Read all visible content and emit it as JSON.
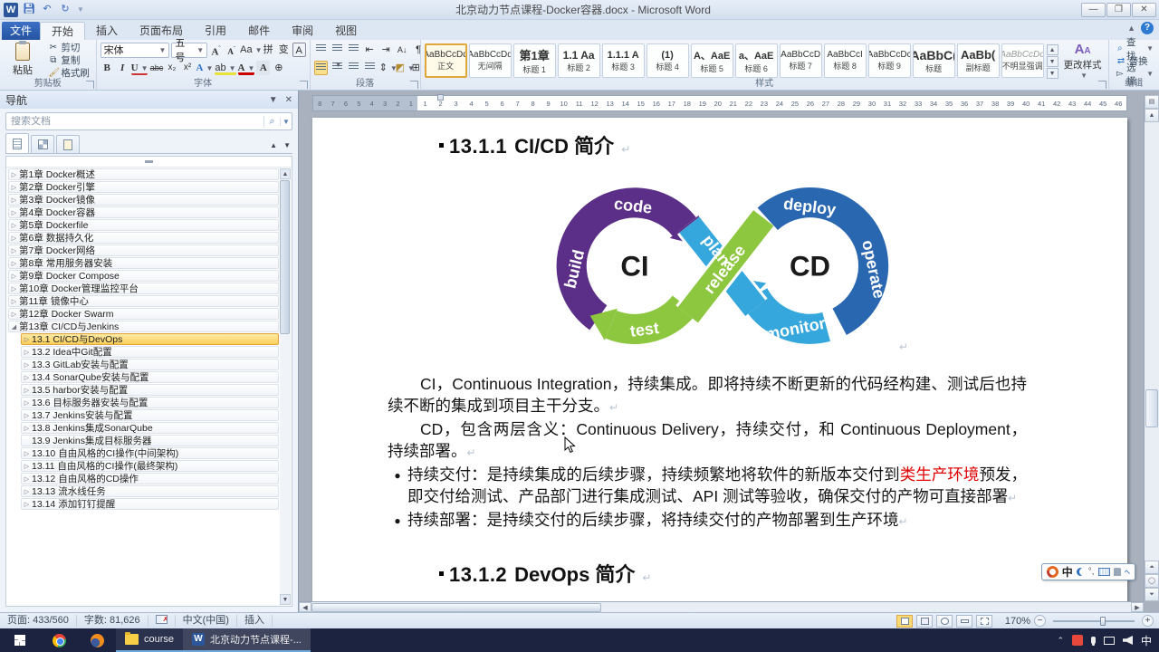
{
  "title_bar": {
    "title": "北京动力节点课程-Docker容器.docx - Microsoft Word"
  },
  "ribbon": {
    "file_tab": "文件",
    "tabs": [
      "开始",
      "插入",
      "页面布局",
      "引用",
      "邮件",
      "审阅",
      "视图"
    ],
    "clipboard": {
      "label": "剪贴板",
      "paste": "粘贴",
      "cut": "剪切",
      "copy": "复制",
      "painter": "格式刷"
    },
    "font": {
      "label": "字体",
      "family": "宋体",
      "size": "五号",
      "bold": "B",
      "italic": "I",
      "underline": "U",
      "strike": "abc",
      "subscript": "x₂",
      "superscript": "x²",
      "grow": "A",
      "shrink": "A",
      "case": "Aa",
      "effects": "A",
      "highlight": "ab",
      "color": "A",
      "pinyin": "拼",
      "clear": "变",
      "boxed": "A",
      "circle": "⊕"
    },
    "paragraph": {
      "label": "段落"
    },
    "styles": {
      "label": "样式",
      "change": "更改样式",
      "items": [
        {
          "preview": "AaBbCcDd",
          "label": "正文",
          "cls": "p10",
          "selected": true
        },
        {
          "preview": "AaBbCcDd",
          "label": "无间隔",
          "cls": "p10",
          "selected": false
        },
        {
          "preview": "第1章",
          "label": "标题 1",
          "cls": "b13",
          "selected": false
        },
        {
          "preview": "1.1 Aa",
          "label": "标题 2",
          "cls": "b12",
          "selected": false
        },
        {
          "preview": "1.1.1 A",
          "label": "标题 3",
          "cls": "b11",
          "selected": false
        },
        {
          "preview": "(1)",
          "label": "标题 4",
          "cls": "b11",
          "selected": false
        },
        {
          "preview": "A、AaE",
          "label": "标题 5",
          "cls": "b11",
          "selected": false
        },
        {
          "preview": "a、AaE",
          "label": "标题 6",
          "cls": "b11",
          "selected": false
        },
        {
          "preview": "AaBbCcD",
          "label": "标题 7",
          "cls": "p10",
          "selected": false
        },
        {
          "preview": "AaBbCcI",
          "label": "标题 8",
          "cls": "p10",
          "selected": false
        },
        {
          "preview": "AaBbCcDc",
          "label": "标题 9",
          "cls": "p10",
          "selected": false
        },
        {
          "preview": "AaBbC(",
          "label": "标题",
          "cls": "b14",
          "selected": false
        },
        {
          "preview": "AaBb(",
          "label": "副标题",
          "cls": "b13",
          "selected": false
        },
        {
          "preview": "AaBbCcDd",
          "label": "不明显强调",
          "cls": "dim",
          "selected": false
        }
      ]
    },
    "editing": {
      "label": "编辑",
      "find": "查找",
      "replace": "替换",
      "select": "选择"
    }
  },
  "nav": {
    "title": "导航",
    "search_placeholder": "搜索文档",
    "items": [
      {
        "text": "第1章 Docker概述",
        "level": 1,
        "state": "collapsed"
      },
      {
        "text": "第2章 Docker引擎",
        "level": 1,
        "state": "collapsed"
      },
      {
        "text": "第3章 Docker镜像",
        "level": 1,
        "state": "collapsed"
      },
      {
        "text": "第4章 Docker容器",
        "level": 1,
        "state": "collapsed"
      },
      {
        "text": "第5章 Dockerfile",
        "level": 1,
        "state": "collapsed"
      },
      {
        "text": "第6章 数据持久化",
        "level": 1,
        "state": "collapsed"
      },
      {
        "text": "第7章 Docker网络",
        "level": 1,
        "state": "collapsed"
      },
      {
        "text": "第8章 常用服务器安装",
        "level": 1,
        "state": "collapsed"
      },
      {
        "text": "第9章 Docker Compose",
        "level": 1,
        "state": "collapsed"
      },
      {
        "text": "第10章 Docker管理监控平台",
        "level": 1,
        "state": "collapsed"
      },
      {
        "text": "第11章 镜像中心",
        "level": 1,
        "state": "collapsed"
      },
      {
        "text": "第12章 Docker Swarm",
        "level": 1,
        "state": "collapsed"
      },
      {
        "text": "第13章 CI/CD与Jenkins",
        "level": 1,
        "state": "expanded"
      },
      {
        "text": "13.1 CI/CD与DevOps",
        "level": 2,
        "state": "collapsed",
        "selected": true
      },
      {
        "text": "13.2 Idea中Git配置",
        "level": 2,
        "state": "collapsed"
      },
      {
        "text": "13.3 GitLab安装与配置",
        "level": 2,
        "state": "collapsed"
      },
      {
        "text": "13.4 SonarQube安装与配置",
        "level": 2,
        "state": "collapsed"
      },
      {
        "text": "13.5 harbor安装与配置",
        "level": 2,
        "state": "collapsed"
      },
      {
        "text": "13.6 目标服务器安装与配置",
        "level": 2,
        "state": "collapsed"
      },
      {
        "text": "13.7 Jenkins安装与配置",
        "level": 2,
        "state": "collapsed"
      },
      {
        "text": "13.8 Jenkins集成SonarQube",
        "level": 2,
        "state": "collapsed"
      },
      {
        "text": "13.9 Jenkins集成目标服务器",
        "level": 2,
        "state": "none"
      },
      {
        "text": "13.10 自由风格的CI操作(中间架构)",
        "level": 2,
        "state": "collapsed"
      },
      {
        "text": "13.11 自由风格的CI操作(最终架构)",
        "level": 2,
        "state": "collapsed"
      },
      {
        "text": "13.12 自由风格的CD操作",
        "level": 2,
        "state": "collapsed"
      },
      {
        "text": "13.13 流水线任务",
        "level": 2,
        "state": "collapsed"
      },
      {
        "text": "13.14 添加钉钉提醒",
        "level": 2,
        "state": "collapsed"
      }
    ]
  },
  "ruler": {
    "margin_numbers": [
      "8",
      "7",
      "6",
      "5",
      "4",
      "3",
      "2",
      "1"
    ],
    "white_count": 46
  },
  "document": {
    "heading1_num": "13.1.1",
    "heading1_text": "CI/CD 简介",
    "heading2_num": "13.1.2",
    "heading2_text": "DevOps 简介",
    "para1": "CI，Continuous Integration，持续集成。即将持续不断更新的代码经构建、测试后也持续不断的集成到项目主干分支。",
    "para2": "CD，包含两层含义：Continuous Delivery，持续交付，和 Continuous Deployment，持续部署。",
    "bullet_marker": "●",
    "bullet1_pre": "持续交付：是持续集成的后续步骤，持续频繁地将软件的新版本交付到",
    "bullet1_red": "类生产环境",
    "bullet1_post": "预发，即交付给测试、产品部门进行集成测试、API 测试等验收，确保交付的产物可直接部署",
    "bullet2": "持续部署：是持续交付的后续步骤，将持续交付的产物部署到生产环境",
    "pilcrow": "↵",
    "red_color": "#e00000"
  },
  "diagram": {
    "ci": "CI",
    "cd": "CD",
    "labels": {
      "code": "code",
      "build": "build",
      "test": "test",
      "plan": "plan",
      "release": "release",
      "deploy": "deploy",
      "operate": "operate",
      "monitor": "monitor"
    },
    "colors": {
      "purple": "#5b2e87",
      "green": "#8dc63f",
      "light_blue": "#35a7dc",
      "dark_blue": "#2a67b1",
      "text_dark": "#1a1a1a"
    }
  },
  "ime_bar": {
    "cn": "中"
  },
  "status_bar": {
    "page": "页面: 433/560",
    "words": "字数: 81,626",
    "lang": "中文(中国)",
    "mode": "插入",
    "zoom": "170%"
  },
  "taskbar": {
    "explorer_label": "course",
    "word_label": "北京动力节点课程-...",
    "tray_ime": "中"
  }
}
